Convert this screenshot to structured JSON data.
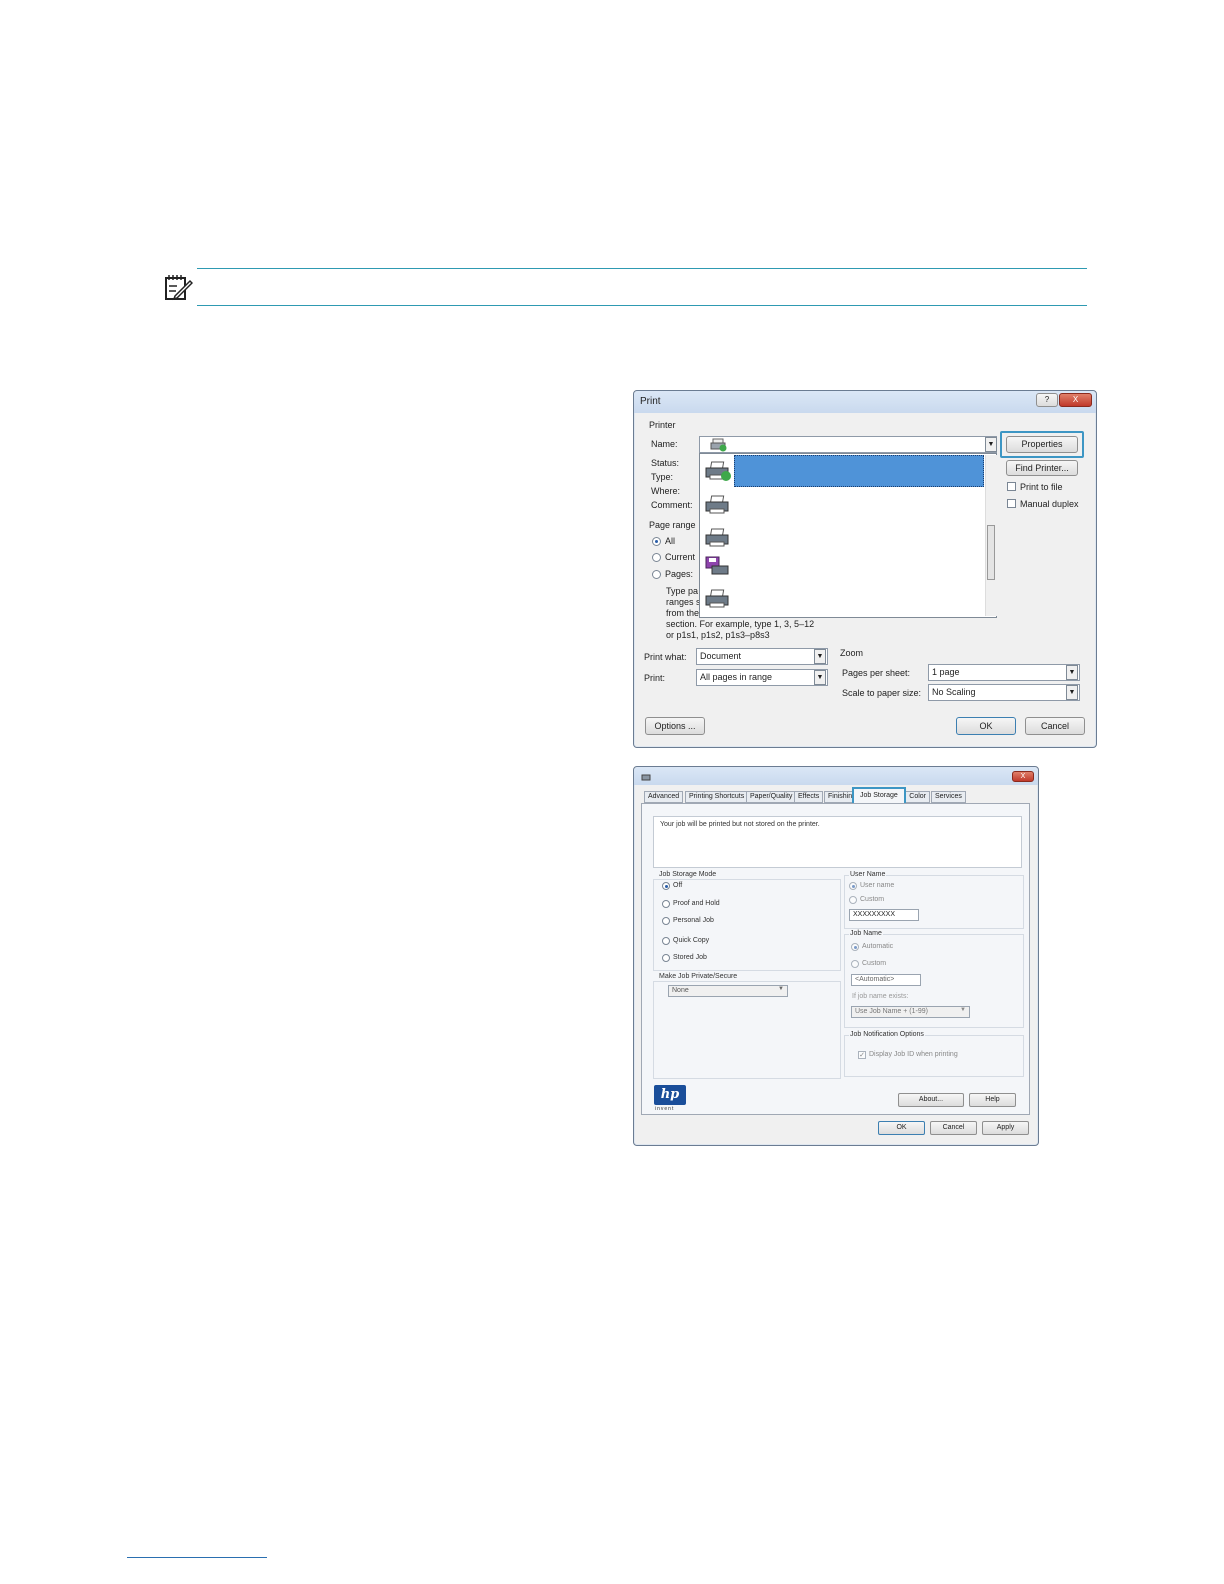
{
  "print_dialog": {
    "title": "Print",
    "printer_group": "Printer",
    "name_label": "Name:",
    "status_label": "Status:",
    "type_label": "Type:",
    "where_label": "Where:",
    "comment_label": "Comment:",
    "properties_label": "Properties",
    "find_printer_label": "Find Printer...",
    "print_to_file_label": "Print to file",
    "manual_duplex_label": "Manual duplex",
    "page_range_label": "Page range",
    "all_label": "All",
    "current_label": "Current",
    "pages_label": "Pages:",
    "hint_lines": [
      "Type pa",
      "ranges s",
      "from the",
      "section. For example, type 1, 3, 5–12",
      "or p1s1, p1s2, p1s3–p8s3"
    ],
    "print_what_label": "Print what:",
    "print_what_value": "Document",
    "print_label": "Print:",
    "print_value": "All pages in range",
    "zoom_label": "Zoom",
    "pages_per_sheet_label": "Pages per sheet:",
    "pages_per_sheet_value": "1 page",
    "scale_label": "Scale to paper size:",
    "scale_value": "No Scaling",
    "options_label": "Options ...",
    "ok_label": "OK",
    "cancel_label": "Cancel",
    "help_glyph": "?",
    "close_glyph": "X"
  },
  "properties_dialog": {
    "tabs": [
      "Advanced",
      "Printing Shortcuts",
      "Paper/Quality",
      "Effects",
      "Finishin",
      "Job Storage",
      "Color",
      "Services"
    ],
    "active_tab": "Job Storage",
    "message": "Your job will be printed but not stored on the printer.",
    "job_storage_mode_label": "Job Storage Mode",
    "modes": [
      "Off",
      "Proof and Hold",
      "Personal Job",
      "Quick Copy",
      "Stored Job"
    ],
    "user_name_label": "User Name",
    "user_name_option": "User name",
    "custom_label": "Custom",
    "user_name_value": "XXXXXXXXX",
    "job_name_label": "Job Name",
    "automatic_label": "Automatic",
    "job_name_value": "<Automatic>",
    "if_exists_label": "If job name exists:",
    "if_exists_value": "Use Job Name + (1-99)",
    "private_label": "Make Job Private/Secure",
    "private_value": "None",
    "notification_label": "Job Notification Options",
    "display_job_id_label": "Display Job ID when printing",
    "logo_text": "hp",
    "invent_text": "invent",
    "about_label": "About...",
    "help_label": "Help",
    "ok_label": "OK",
    "cancel_label": "Cancel",
    "apply_label": "Apply",
    "close_glyph": "X"
  },
  "colors": {
    "accent_rule": "#2e9ab2",
    "highlight_blue": "#4f93d8",
    "callout_border": "#3d96c4"
  }
}
